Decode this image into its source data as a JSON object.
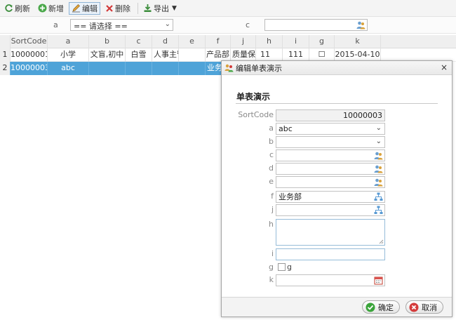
{
  "toolbar": {
    "refresh": "刷新",
    "add": "新增",
    "edit": "编辑",
    "delete": "删除",
    "export": "导出",
    "caret": "▼"
  },
  "filter": {
    "a_label": "a",
    "a_value": "== 请选择 ==",
    "c_label": "c",
    "arrow": "⌄"
  },
  "grid": {
    "columns": [
      "SortCode",
      "a",
      "b",
      "c",
      "d",
      "e",
      "f",
      "j",
      "h",
      "i",
      "g",
      "k"
    ],
    "rows": [
      {
        "rn": "1",
        "SortCode": "10000001",
        "a": "小学",
        "b": "文盲,初中",
        "c": "白雪",
        "d": "人事主管",
        "e": "",
        "f": "产品部",
        "j": "质量保证",
        "h": "11",
        "i": "111",
        "g": "☐",
        "k": "2015-04-10"
      },
      {
        "rn": "2",
        "SortCode": "10000003",
        "a": "abc",
        "b": "",
        "c": "",
        "d": "",
        "e": "",
        "f": "业务部",
        "j": "",
        "h": "",
        "i": "",
        "g": "",
        "k": ""
      }
    ]
  },
  "dialog": {
    "title": "编辑单表演示",
    "close": "×",
    "form_title": "单表演示",
    "fields": {
      "sortcode_label": "SortCode",
      "sortcode_value": "10000003",
      "a_label": "a",
      "a_value": "abc",
      "b_label": "b",
      "c_label": "c",
      "d_label": "d",
      "e_label": "e",
      "f_label": "f",
      "f_value": "业务部",
      "j_label": "j",
      "h_label": "h",
      "i_label": "i",
      "g_label": "g",
      "g_checkbox_label": "g",
      "k_label": "k"
    },
    "ok": "确定",
    "cancel": "取消"
  },
  "colors": {
    "selected_row": "#4ea3d8",
    "ok_icon": "#3aa43a",
    "cancel_icon": "#d43c3c"
  }
}
